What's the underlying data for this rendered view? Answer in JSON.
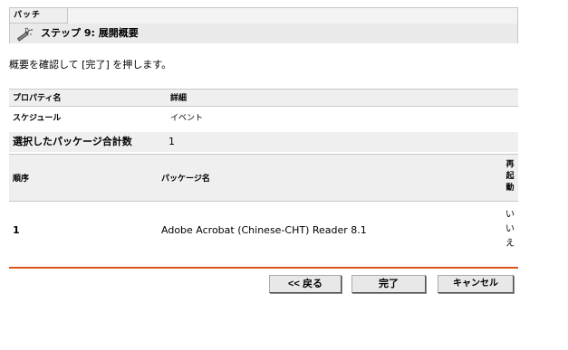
{
  "header": {
    "tab_label": "パッチ",
    "step_title": "ステップ 9: 展開概要"
  },
  "instruction": "概要を確認して [完了] を押します。",
  "properties": {
    "columns": [
      "プロパティ名",
      "詳細"
    ],
    "rows": [
      [
        "スケジュール",
        "イベント"
      ]
    ]
  },
  "summary": {
    "label": "選択したパッケージ合計数",
    "count": "1"
  },
  "bundles": {
    "columns": [
      "順序",
      "パッケージ名",
      "再起動"
    ],
    "rows": [
      {
        "seq": "1",
        "name": "Adobe Acrobat (Chinese-CHT) Reader 8.1",
        "reboot": "いいえ"
      }
    ]
  },
  "buttons": {
    "back": "<< 戻る",
    "finish": "完了",
    "cancel": "キャンセル"
  },
  "colors": {
    "divider": "#d9551a",
    "header_bg": "#efefef"
  },
  "icons": {
    "step": "wizard-wand-icon"
  }
}
